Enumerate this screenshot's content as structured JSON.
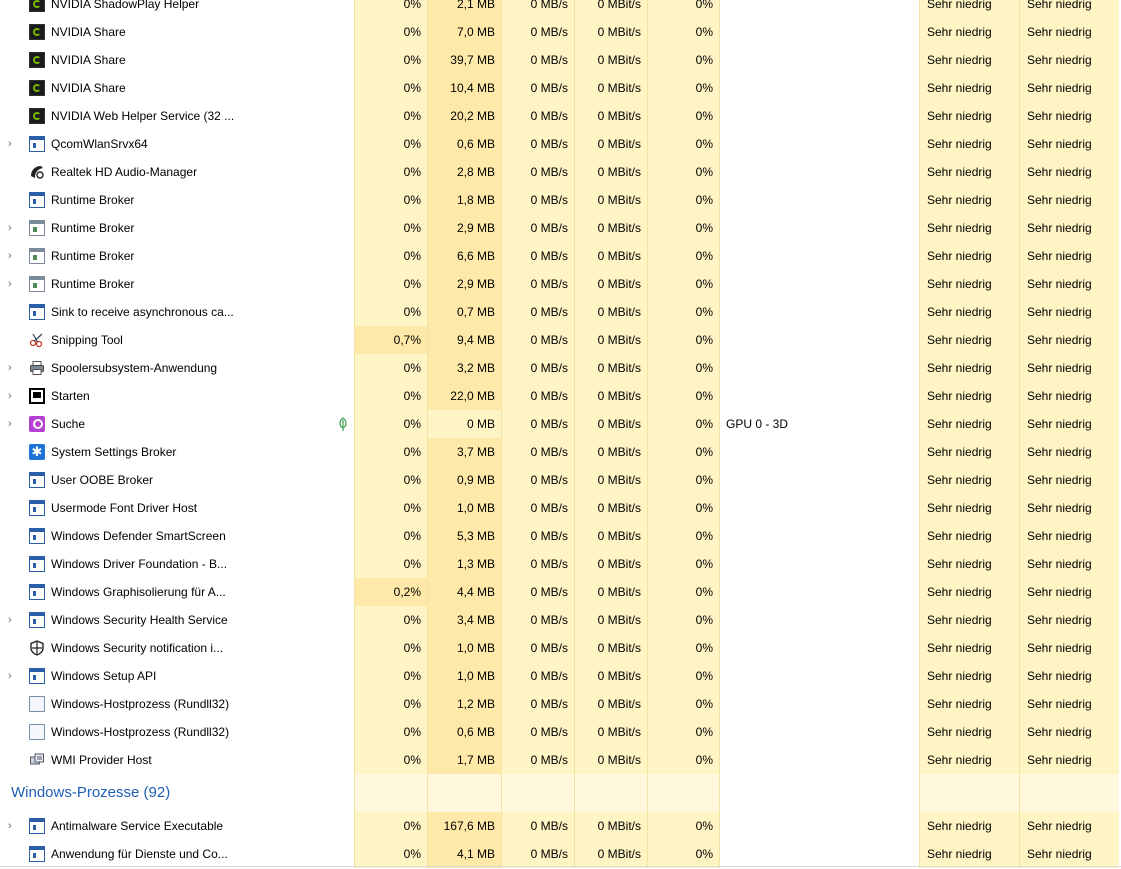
{
  "rows_top": [
    {
      "name": "NVIDIA ShadowPlay Helper",
      "icon": "nvidia-icon",
      "expand": false,
      "cpu": "0%",
      "mem": "2,1 MB",
      "disk": "0 MB/s",
      "net": "0 MBit/s",
      "gpu": "0%",
      "engine": "",
      "power": "Sehr niedrig",
      "trend": "Sehr niedrig"
    },
    {
      "name": "NVIDIA Share",
      "icon": "nvidia-icon",
      "expand": false,
      "cpu": "0%",
      "mem": "7,0 MB",
      "disk": "0 MB/s",
      "net": "0 MBit/s",
      "gpu": "0%",
      "engine": "",
      "power": "Sehr niedrig",
      "trend": "Sehr niedrig"
    },
    {
      "name": "NVIDIA Share",
      "icon": "nvidia-icon",
      "expand": false,
      "cpu": "0%",
      "mem": "39,7 MB",
      "disk": "0 MB/s",
      "net": "0 MBit/s",
      "gpu": "0%",
      "engine": "",
      "power": "Sehr niedrig",
      "trend": "Sehr niedrig"
    },
    {
      "name": "NVIDIA Share",
      "icon": "nvidia-icon",
      "expand": false,
      "cpu": "0%",
      "mem": "10,4 MB",
      "disk": "0 MB/s",
      "net": "0 MBit/s",
      "gpu": "0%",
      "engine": "",
      "power": "Sehr niedrig",
      "trend": "Sehr niedrig"
    },
    {
      "name": "NVIDIA Web Helper Service (32 ...",
      "icon": "nvidia-icon",
      "expand": false,
      "cpu": "0%",
      "mem": "20,2 MB",
      "disk": "0 MB/s",
      "net": "0 MBit/s",
      "gpu": "0%",
      "engine": "",
      "power": "Sehr niedrig",
      "trend": "Sehr niedrig"
    },
    {
      "name": "QcomWlanSrvx64",
      "icon": "window-icon",
      "expand": true,
      "cpu": "0%",
      "mem": "0,6 MB",
      "disk": "0 MB/s",
      "net": "0 MBit/s",
      "gpu": "0%",
      "engine": "",
      "power": "Sehr niedrig",
      "trend": "Sehr niedrig"
    },
    {
      "name": "Realtek HD Audio-Manager",
      "icon": "audio-icon",
      "expand": false,
      "cpu": "0%",
      "mem": "2,8 MB",
      "disk": "0 MB/s",
      "net": "0 MBit/s",
      "gpu": "0%",
      "engine": "",
      "power": "Sehr niedrig",
      "trend": "Sehr niedrig"
    },
    {
      "name": "Runtime Broker",
      "icon": "window-icon",
      "expand": false,
      "cpu": "0%",
      "mem": "1,8 MB",
      "disk": "0 MB/s",
      "net": "0 MBit/s",
      "gpu": "0%",
      "engine": "",
      "power": "Sehr niedrig",
      "trend": "Sehr niedrig"
    },
    {
      "name": "Runtime Broker",
      "icon": "window-alt-icon",
      "expand": true,
      "cpu": "0%",
      "mem": "2,9 MB",
      "disk": "0 MB/s",
      "net": "0 MBit/s",
      "gpu": "0%",
      "engine": "",
      "power": "Sehr niedrig",
      "trend": "Sehr niedrig"
    },
    {
      "name": "Runtime Broker",
      "icon": "window-alt-icon",
      "expand": true,
      "cpu": "0%",
      "mem": "6,6 MB",
      "disk": "0 MB/s",
      "net": "0 MBit/s",
      "gpu": "0%",
      "engine": "",
      "power": "Sehr niedrig",
      "trend": "Sehr niedrig"
    },
    {
      "name": "Runtime Broker",
      "icon": "window-alt-icon",
      "expand": true,
      "cpu": "0%",
      "mem": "2,9 MB",
      "disk": "0 MB/s",
      "net": "0 MBit/s",
      "gpu": "0%",
      "engine": "",
      "power": "Sehr niedrig",
      "trend": "Sehr niedrig"
    },
    {
      "name": "Sink to receive asynchronous ca...",
      "icon": "window-icon",
      "expand": false,
      "cpu": "0%",
      "mem": "0,7 MB",
      "disk": "0 MB/s",
      "net": "0 MBit/s",
      "gpu": "0%",
      "engine": "",
      "power": "Sehr niedrig",
      "trend": "Sehr niedrig"
    },
    {
      "name": "Snipping Tool",
      "icon": "scissors-icon",
      "expand": false,
      "cpu": "0,7%",
      "cpu_high": true,
      "mem": "9,4 MB",
      "disk": "0 MB/s",
      "net": "0 MBit/s",
      "gpu": "0%",
      "engine": "",
      "power": "Sehr niedrig",
      "trend": "Sehr niedrig"
    },
    {
      "name": "Spoolersubsystem-Anwendung",
      "icon": "printer-icon",
      "expand": true,
      "cpu": "0%",
      "mem": "3,2 MB",
      "disk": "0 MB/s",
      "net": "0 MBit/s",
      "gpu": "0%",
      "engine": "",
      "power": "Sehr niedrig",
      "trend": "Sehr niedrig"
    },
    {
      "name": "Starten",
      "icon": "start-icon",
      "expand": true,
      "cpu": "0%",
      "mem": "22,0 MB",
      "disk": "0 MB/s",
      "net": "0 MBit/s",
      "gpu": "0%",
      "engine": "",
      "power": "Sehr niedrig",
      "trend": "Sehr niedrig"
    },
    {
      "name": "Suche",
      "icon": "search-icon",
      "expand": true,
      "leaf": true,
      "cpu": "0%",
      "mem": "0 MB",
      "mem_low": true,
      "disk": "0 MB/s",
      "net": "0 MBit/s",
      "gpu": "0%",
      "engine": "GPU 0 - 3D",
      "power": "Sehr niedrig",
      "trend": "Sehr niedrig"
    },
    {
      "name": "System Settings Broker",
      "icon": "gear-icon",
      "expand": false,
      "cpu": "0%",
      "mem": "3,7 MB",
      "disk": "0 MB/s",
      "net": "0 MBit/s",
      "gpu": "0%",
      "engine": "",
      "power": "Sehr niedrig",
      "trend": "Sehr niedrig"
    },
    {
      "name": "User OOBE Broker",
      "icon": "window-icon",
      "expand": false,
      "cpu": "0%",
      "mem": "0,9 MB",
      "disk": "0 MB/s",
      "net": "0 MBit/s",
      "gpu": "0%",
      "engine": "",
      "power": "Sehr niedrig",
      "trend": "Sehr niedrig"
    },
    {
      "name": "Usermode Font Driver Host",
      "icon": "window-icon",
      "expand": false,
      "cpu": "0%",
      "mem": "1,0 MB",
      "disk": "0 MB/s",
      "net": "0 MBit/s",
      "gpu": "0%",
      "engine": "",
      "power": "Sehr niedrig",
      "trend": "Sehr niedrig"
    },
    {
      "name": "Windows Defender SmartScreen",
      "icon": "window-icon",
      "expand": false,
      "cpu": "0%",
      "mem": "5,3 MB",
      "disk": "0 MB/s",
      "net": "0 MBit/s",
      "gpu": "0%",
      "engine": "",
      "power": "Sehr niedrig",
      "trend": "Sehr niedrig"
    },
    {
      "name": "Windows Driver Foundation - B...",
      "icon": "window-icon",
      "expand": false,
      "cpu": "0%",
      "mem": "1,3 MB",
      "disk": "0 MB/s",
      "net": "0 MBit/s",
      "gpu": "0%",
      "engine": "",
      "power": "Sehr niedrig",
      "trend": "Sehr niedrig"
    },
    {
      "name": "Windows Graphisolierung für A...",
      "icon": "window-icon",
      "expand": false,
      "cpu": "0,2%",
      "cpu_high": true,
      "mem": "4,4 MB",
      "disk": "0 MB/s",
      "net": "0 MBit/s",
      "gpu": "0%",
      "engine": "",
      "power": "Sehr niedrig",
      "trend": "Sehr niedrig"
    },
    {
      "name": "Windows Security Health Service",
      "icon": "window-icon",
      "expand": true,
      "cpu": "0%",
      "mem": "3,4 MB",
      "disk": "0 MB/s",
      "net": "0 MBit/s",
      "gpu": "0%",
      "engine": "",
      "power": "Sehr niedrig",
      "trend": "Sehr niedrig"
    },
    {
      "name": "Windows Security notification i...",
      "icon": "shield-icon",
      "expand": false,
      "cpu": "0%",
      "mem": "1,0 MB",
      "disk": "0 MB/s",
      "net": "0 MBit/s",
      "gpu": "0%",
      "engine": "",
      "power": "Sehr niedrig",
      "trend": "Sehr niedrig"
    },
    {
      "name": "Windows Setup API",
      "icon": "window-icon",
      "expand": true,
      "cpu": "0%",
      "mem": "1,0 MB",
      "disk": "0 MB/s",
      "net": "0 MBit/s",
      "gpu": "0%",
      "engine": "",
      "power": "Sehr niedrig",
      "trend": "Sehr niedrig"
    },
    {
      "name": "Windows-Hostprozess (Rundll32)",
      "icon": "document-icon",
      "expand": false,
      "cpu": "0%",
      "mem": "1,2 MB",
      "disk": "0 MB/s",
      "net": "0 MBit/s",
      "gpu": "0%",
      "engine": "",
      "power": "Sehr niedrig",
      "trend": "Sehr niedrig"
    },
    {
      "name": "Windows-Hostprozess (Rundll32)",
      "icon": "document-icon",
      "expand": false,
      "cpu": "0%",
      "mem": "0,6 MB",
      "disk": "0 MB/s",
      "net": "0 MBit/s",
      "gpu": "0%",
      "engine": "",
      "power": "Sehr niedrig",
      "trend": "Sehr niedrig"
    },
    {
      "name": "WMI Provider Host",
      "icon": "wmi-icon",
      "expand": false,
      "cpu": "0%",
      "mem": "1,7 MB",
      "disk": "0 MB/s",
      "net": "0 MBit/s",
      "gpu": "0%",
      "engine": "",
      "power": "Sehr niedrig",
      "trend": "Sehr niedrig"
    }
  ],
  "group": {
    "label": "Windows-Prozesse (92)"
  },
  "rows_bottom": [
    {
      "name": "Antimalware Service Executable",
      "icon": "window-icon",
      "expand": true,
      "cpu": "0%",
      "mem": "167,6 MB",
      "disk": "0 MB/s",
      "net": "0 MBit/s",
      "gpu": "0%",
      "engine": "",
      "power": "Sehr niedrig",
      "trend": "Sehr niedrig"
    },
    {
      "name": "Anwendung für Dienste und Co...",
      "icon": "window-icon",
      "expand": false,
      "cpu": "0%",
      "mem": "4,1 MB",
      "disk": "0 MB/s",
      "net": "0 MBit/s",
      "gpu": "0%",
      "engine": "",
      "power": "Sehr niedrig",
      "trend": "Sehr niedrig"
    }
  ],
  "colors": {
    "cell": "#fff4c4",
    "cell_high": "#ffe9a8",
    "group_text": "#1f5fb4",
    "leaf": "#3aa04a"
  }
}
